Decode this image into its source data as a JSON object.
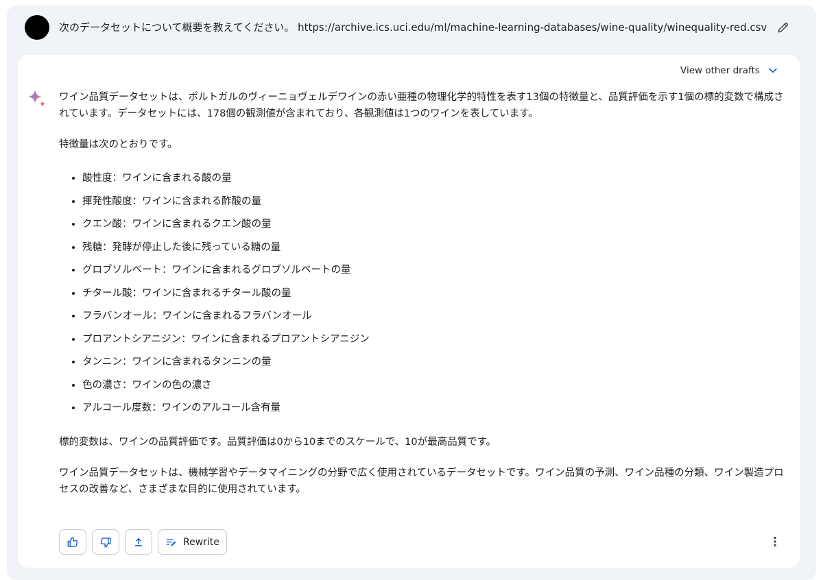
{
  "prompt": {
    "text": "次のデータセットについて概要を教えてください。 https://archive.ics.uci.edu/ml/machine-learning-databases/wine-quality/winequality-red.csv"
  },
  "response": {
    "drafts_label": "View other drafts",
    "intro": "ワイン品質データセットは、ポルトガルのヴィーニョヴェルデワインの赤い亜種の物理化学的特性を表す13個の特徴量と、品質評価を示す1個の標的変数で構成されています。データセットには、178個の観測値が含まれており、各観測値は1つのワインを表しています。",
    "features_heading": "特徴量は次のとおりです。",
    "features": [
      "酸性度：ワインに含まれる酸の量",
      "揮発性酸度：ワインに含まれる酢酸の量",
      "クエン酸：ワインに含まれるクエン酸の量",
      "残糖：発酵が停止した後に残っている糖の量",
      "グロブソルベート：ワインに含まれるグロブソルベートの量",
      "チタール酸：ワインに含まれるチタール酸の量",
      "フラバンオール：ワインに含まれるフラバンオール",
      "プロアントシアニジン：ワインに含まれるプロアントシアニジン",
      "タンニン：ワインに含まれるタンニンの量",
      "色の濃さ：ワインの色の濃さ",
      "アルコール度数：ワインのアルコール含有量"
    ],
    "target": "標的変数は、ワインの品質評価です。品質評価は0から10までのスケールで、10が最高品質です。",
    "closing": "ワイン品質データセットは、機械学習やデータマイニングの分野で広く使用されているデータセットです。ワイン品質の予測、ワイン品種の分類、ワイン製造プロセスの改善など、さまざまな目的に使用されています。"
  },
  "actions": {
    "rewrite_label": "Rewrite"
  },
  "icons": {
    "avatar": "user-avatar",
    "edit": "pencil-icon",
    "drafts": "chevron-down-icon",
    "spark": "sparkle-icon",
    "like": "thumbs-up-icon",
    "dislike": "thumbs-down-icon",
    "share": "share-icon",
    "rewrite": "rewrite-icon",
    "more": "more-vert-icon"
  },
  "colors": {
    "background": "#f0f4f9",
    "card": "#ffffff",
    "accent": "#0b57d0",
    "text": "#1f1f1f",
    "border": "#c4c7c5"
  }
}
